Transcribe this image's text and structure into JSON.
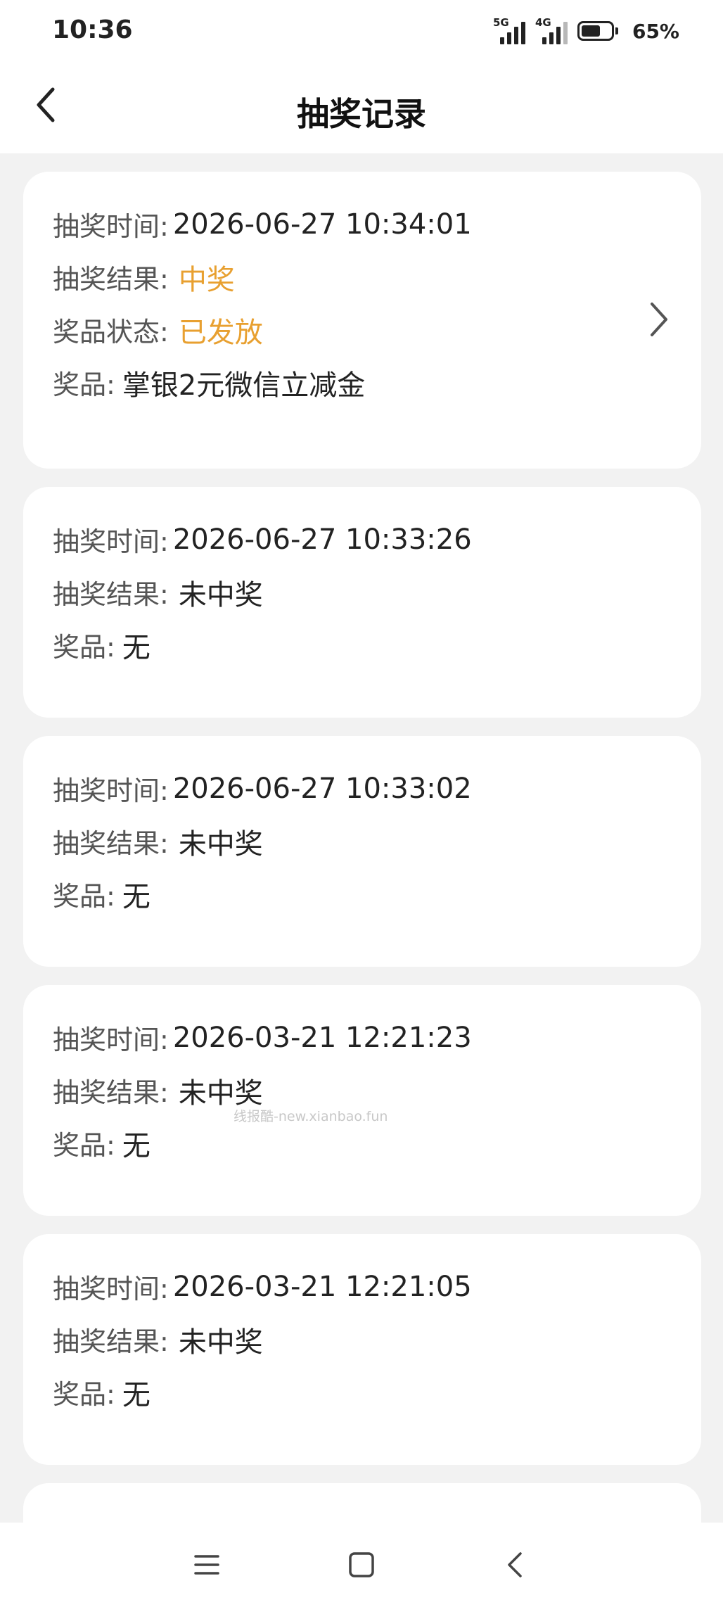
{
  "status_bar": {
    "time": "10:36",
    "network_1": "5G",
    "network_2": "4G",
    "battery": "65%",
    "battery_level": 0.65
  },
  "header": {
    "title": "抽奖记录",
    "back_icon": "chevron-left-icon"
  },
  "colors": {
    "highlight": "#e8a030",
    "label": "#555555",
    "value": "#222222",
    "background": "#f2f2f2"
  },
  "labels": {
    "time": "抽奖时间:",
    "result": "抽奖结果:",
    "status": "奖品状态:",
    "prize": "奖品:"
  },
  "records": [
    {
      "time": "2026-06-27 10:34:01",
      "result": "中奖",
      "status": "已发放",
      "prize": "掌银2元微信立减金"
    },
    {
      "time": "2026-06-27 10:33:26",
      "result": "未中奖",
      "prize": "无"
    },
    {
      "time": "2026-06-27 10:33:02",
      "result": "未中奖",
      "prize": "无"
    },
    {
      "time": "2026-03-21 12:21:23",
      "result": "未中奖",
      "prize": "无"
    },
    {
      "time": "2026-03-21 12:21:05",
      "result": "未中奖",
      "prize": "无"
    }
  ],
  "watermark": "线报酷-new.xianbao.fun",
  "nav_bar": {
    "menu_icon": "menu-icon",
    "home_icon": "home-square-icon",
    "back_icon": "back-triangle-icon"
  }
}
